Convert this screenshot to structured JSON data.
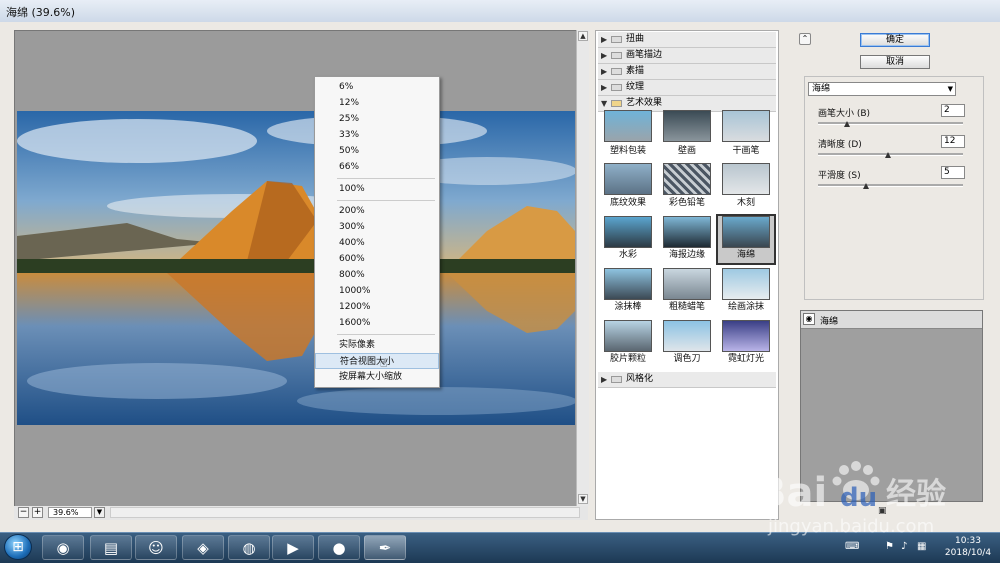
{
  "window": {
    "title": "海绵 (39.6%)"
  },
  "preview": {
    "zoom_value": "39.6%",
    "minus": "−",
    "plus": "+"
  },
  "context_menu": {
    "group1": [
      "6%",
      "12%",
      "25%",
      "33%",
      "50%",
      "66%"
    ],
    "group2": [
      "100%"
    ],
    "group3": [
      "200%",
      "300%",
      "400%",
      "600%",
      "800%",
      "1000%",
      "1200%",
      "1600%"
    ],
    "group4": [
      "实际像素",
      "符合视图大小",
      "按屏幕大小缩放"
    ],
    "highlighted": "符合视图大小"
  },
  "gallery": {
    "categories_top": [
      "扭曲",
      "画笔描边",
      "素描",
      "纹理",
      "艺术效果"
    ],
    "category_bottom": "风格化",
    "filters": [
      "塑料包装",
      "壁画",
      "干画笔",
      "底纹效果",
      "彩色铅笔",
      "木刻",
      "水彩",
      "海报边缘",
      "海绵",
      "涂抹棒",
      "粗糙蜡笔",
      "绘画涂抹",
      "胶片颗粒",
      "调色刀",
      "霓虹灯光"
    ],
    "selected": "海绵"
  },
  "buttons": {
    "ok": "确定",
    "cancel": "取消",
    "collapse": "⌃"
  },
  "settings": {
    "filter_select": "海绵",
    "params": [
      {
        "label": "画笔大小 (B)",
        "value": "2",
        "level": 0.2
      },
      {
        "label": "清晰度 (D)",
        "value": "12",
        "level": 0.48
      },
      {
        "label": "平滑度 (S)",
        "value": "5",
        "level": 0.33
      }
    ]
  },
  "layers": {
    "name": "海绵"
  },
  "taskbar": {
    "time": "10:33",
    "date": "2018/10/4"
  },
  "watermark": {
    "brand": "Bai",
    "brand2": "du",
    "cn": "经验",
    "url": "jingyan.baidu.com"
  },
  "colors": {
    "sky": "#2f6fb0",
    "mountain": "#d9892a",
    "selected_frame": "#333333",
    "taskbar": "#2a4a6a"
  }
}
